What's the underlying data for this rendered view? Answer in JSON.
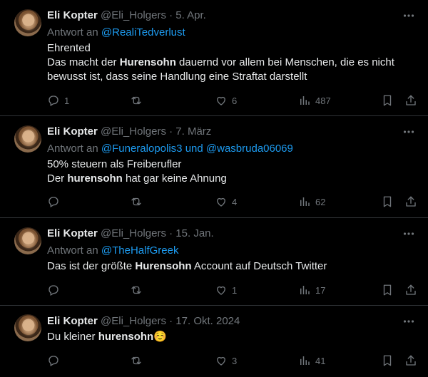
{
  "tweets": [
    {
      "name": "Eli Kopter",
      "handle": "@Eli_Holgers",
      "dot": "·",
      "date": "5. Apr.",
      "reply_prefix": "Antwort an",
      "mentions": [
        "@RealiTedverlust"
      ],
      "reply_joiner": "",
      "lines": [
        {
          "pre": "Ehrented",
          "bold": "",
          "post": ""
        },
        {
          "pre": "Das macht der ",
          "bold": "Hurensohn",
          "post": " dauernd vor allem bei Menschen, die es nicht bewusst ist, dass seine Handlung eine Straftat darstellt"
        }
      ],
      "stats": {
        "replies": "1",
        "retweets": "",
        "likes": "6",
        "views": "487"
      }
    },
    {
      "name": "Eli Kopter",
      "handle": "@Eli_Holgers",
      "dot": "·",
      "date": "7. März",
      "reply_prefix": "Antwort an",
      "mentions": [
        "@Funeralopolis3",
        "@wasbruda06069"
      ],
      "reply_joiner": "und",
      "lines": [
        {
          "pre": "50% steuern als Freiberufler",
          "bold": "",
          "post": ""
        },
        {
          "pre": "Der ",
          "bold": "hurensohn",
          "post": " hat gar keine Ahnung"
        }
      ],
      "stats": {
        "replies": "",
        "retweets": "",
        "likes": "4",
        "views": "62"
      }
    },
    {
      "name": "Eli Kopter",
      "handle": "@Eli_Holgers",
      "dot": "·",
      "date": "15. Jan.",
      "reply_prefix": "Antwort an",
      "mentions": [
        "@TheHalfGreek"
      ],
      "reply_joiner": "",
      "lines": [
        {
          "pre": "Das ist der größte ",
          "bold": "Hurensohn",
          "post": " Account auf Deutsch Twitter"
        }
      ],
      "stats": {
        "replies": "",
        "retweets": "",
        "likes": "1",
        "views": "17"
      }
    },
    {
      "name": "Eli Kopter",
      "handle": "@Eli_Holgers",
      "dot": "·",
      "date": "17. Okt. 2024",
      "reply_prefix": "",
      "mentions": [],
      "reply_joiner": "",
      "lines": [
        {
          "pre": "Du kleiner ",
          "bold": "hurensohn",
          "post": "☺️"
        }
      ],
      "stats": {
        "replies": "",
        "retweets": "",
        "likes": "3",
        "views": "41"
      }
    }
  ],
  "icons": {
    "more": "more-icon",
    "reply": "reply-icon",
    "retweet": "retweet-icon",
    "like": "like-icon",
    "views": "views-icon",
    "bookmark": "bookmark-icon",
    "share": "share-icon"
  },
  "colors": {
    "background": "#000000",
    "text": "#e7e9ea",
    "muted": "#71767b",
    "link": "#1d9bf0",
    "divider": "#2f3336"
  }
}
